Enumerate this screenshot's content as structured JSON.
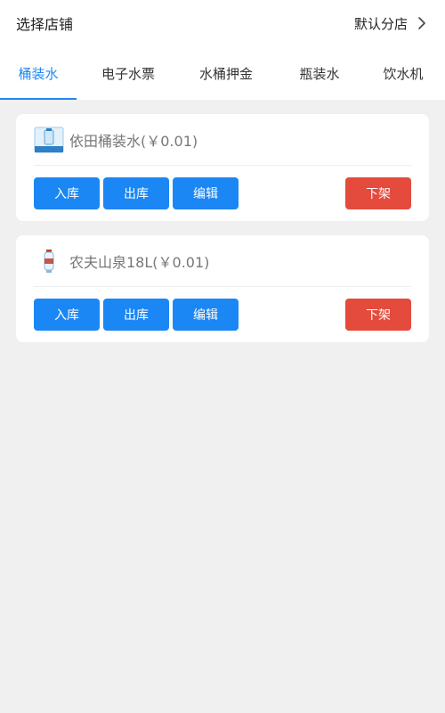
{
  "header": {
    "title": "选择店铺",
    "store_label": "默认分店"
  },
  "tabs": [
    {
      "label": "桶装水",
      "active": true
    },
    {
      "label": "电子水票",
      "active": false
    },
    {
      "label": "水桶押金",
      "active": false
    },
    {
      "label": "瓶装水",
      "active": false
    },
    {
      "label": "饮水机",
      "active": false
    }
  ],
  "colors": {
    "accent": "#1e88f5",
    "danger": "#e44b3c",
    "background": "#f0f0f0"
  },
  "products": [
    {
      "name": "依田桶装水(￥0.01)",
      "icon": "water-bucket-icon",
      "buttons": {
        "stock_in": "入库",
        "stock_out": "出库",
        "edit": "编辑",
        "delist": "下架"
      }
    },
    {
      "name": "农夫山泉18L(￥0.01)",
      "icon": "water-bottle-icon",
      "buttons": {
        "stock_in": "入库",
        "stock_out": "出库",
        "edit": "编辑",
        "delist": "下架"
      }
    }
  ]
}
